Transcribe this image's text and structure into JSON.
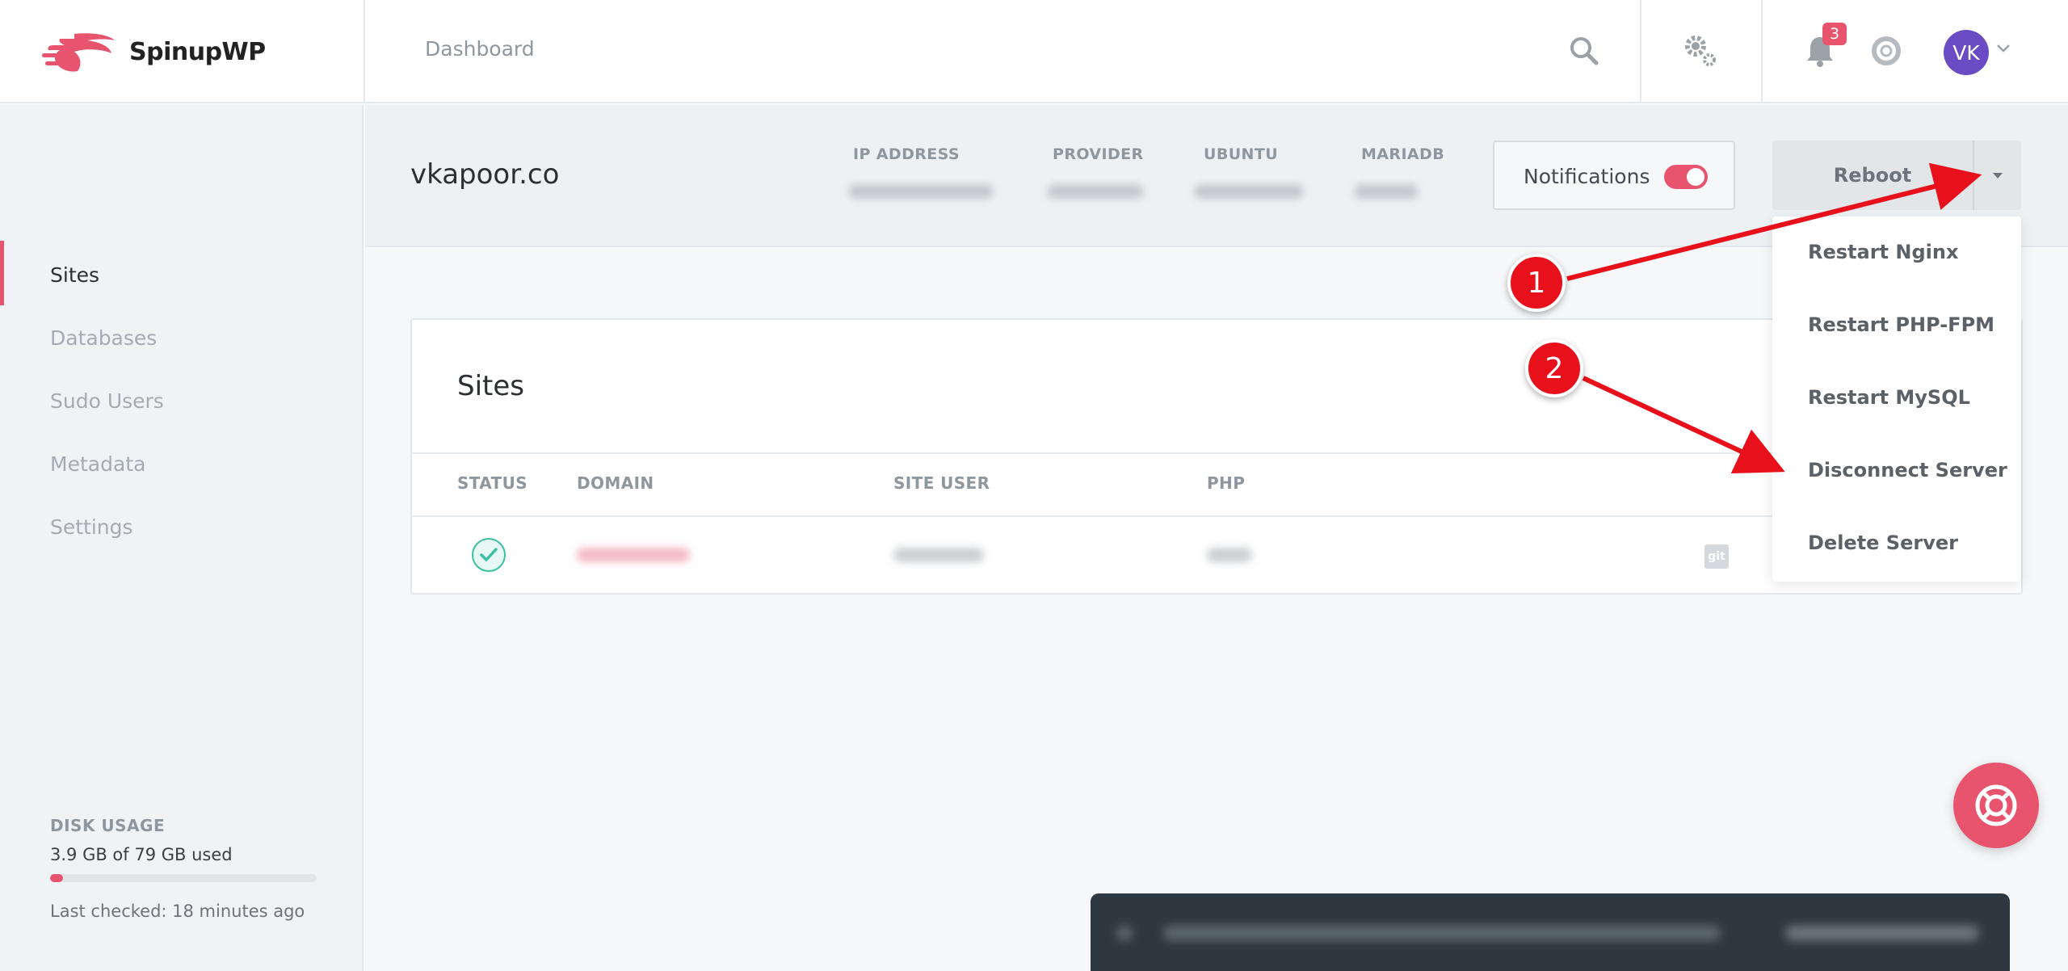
{
  "app": {
    "brand": "SpinupWP"
  },
  "topnav": {
    "dashboard_label": "Dashboard",
    "notification_count": "3",
    "avatar_initials": "VK"
  },
  "sidebar": {
    "items": [
      {
        "label": "Sites",
        "active": true
      },
      {
        "label": "Databases",
        "active": false
      },
      {
        "label": "Sudo Users",
        "active": false
      },
      {
        "label": "Metadata",
        "active": false
      },
      {
        "label": "Settings",
        "active": false
      }
    ],
    "disk": {
      "title": "DISK USAGE",
      "used_text": "3.9 GB of 79 GB used",
      "used_fraction": 0.049,
      "last_checked": "Last checked: 18 minutes ago"
    }
  },
  "server": {
    "name": "vkapoor.co",
    "meta_labels": [
      "IP ADDRESS",
      "PROVIDER",
      "UBUNTU",
      "MARIADB"
    ],
    "notifications_label": "Notifications",
    "notifications_on": true,
    "reboot_label": "Reboot"
  },
  "dropdown": {
    "items": [
      "Restart Nginx",
      "Restart PHP-FPM",
      "Restart MySQL",
      "Disconnect Server",
      "Delete Server"
    ]
  },
  "sites_card": {
    "title": "Sites",
    "columns": [
      "STATUS",
      "DOMAIN",
      "SITE USER",
      "PHP"
    ],
    "git_label": "git"
  },
  "annotations": {
    "callout_1": "1",
    "callout_2": "2"
  },
  "colors": {
    "accent": "#e8546e",
    "success": "#3cc0a2",
    "avatar": "#6a4bc4",
    "arrow": "#e8101a"
  }
}
